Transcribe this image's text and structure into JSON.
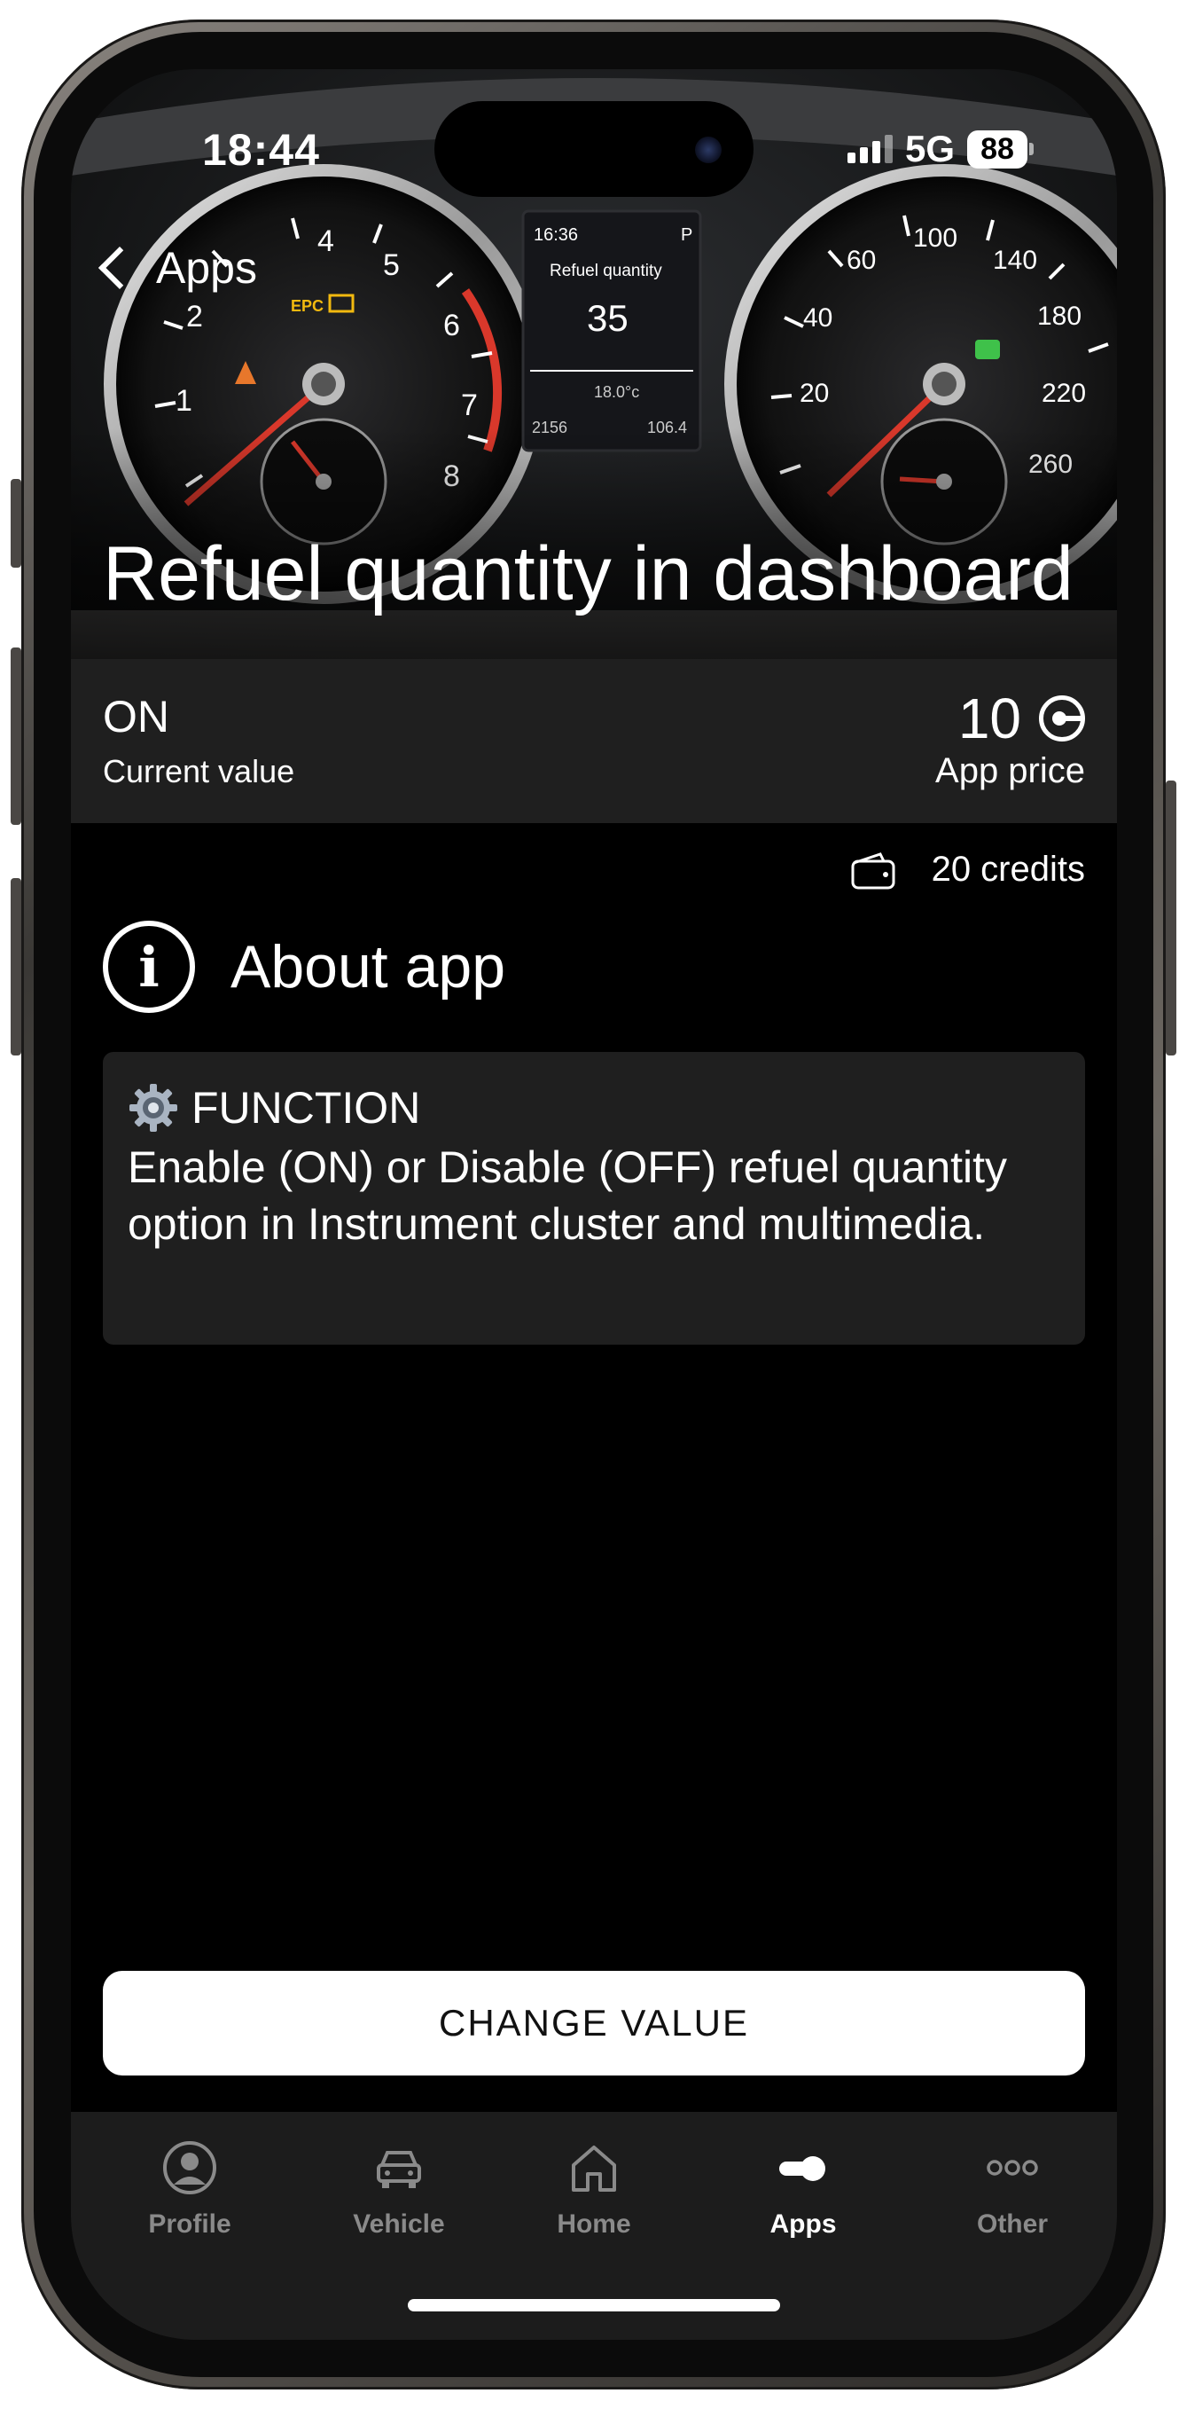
{
  "status_bar": {
    "time": "18:44",
    "network": "5G",
    "battery": "88"
  },
  "nav": {
    "back_label": "Apps"
  },
  "hero": {
    "title": "Refuel quantity in dashboard",
    "display": {
      "clock": "16:36",
      "gear": "P",
      "label": "Refuel quantity",
      "value": "35",
      "temp": "18.0°c",
      "odo_left": "2156",
      "odo_right": "106.4"
    },
    "tach_numbers": [
      "1",
      "2",
      "4",
      "5",
      "6",
      "7",
      "8"
    ],
    "speed_numbers": [
      "20",
      "40",
      "60",
      "100",
      "140",
      "180",
      "220",
      "260"
    ]
  },
  "current": {
    "value": "ON",
    "label": "Current value"
  },
  "price": {
    "value": "10",
    "label": "App price"
  },
  "credits": {
    "text": "20 credits"
  },
  "about": {
    "title": "About app",
    "function_label": "FUNCTION",
    "function_text": "Enable (ON) or Disable (OFF) refuel quantity option in Instrument cluster and multimedia."
  },
  "action": {
    "label": "CHANGE VALUE"
  },
  "tabs": [
    {
      "label": "Profile",
      "icon": "profile-icon",
      "active": false
    },
    {
      "label": "Vehicle",
      "icon": "car-icon",
      "active": false
    },
    {
      "label": "Home",
      "icon": "home-icon",
      "active": false
    },
    {
      "label": "Apps",
      "icon": "toggle-icon",
      "active": true
    },
    {
      "label": "Other",
      "icon": "more-icon",
      "active": false
    }
  ],
  "colors": {
    "background": "#000000",
    "card": "#1f1f1f",
    "tabbar": "#1c1c1c",
    "inactive_tab": "#8a8a8a",
    "needle": "#d9382b"
  }
}
